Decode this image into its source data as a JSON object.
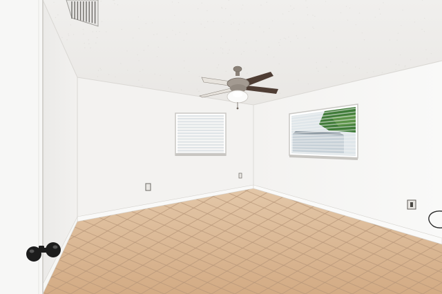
{
  "scene": {
    "type": "photo",
    "subject": "empty-room",
    "colors": {
      "ceiling": "#f1f0ee",
      "wall_left": "#f3f2f0",
      "wall_back": "#f4f3f1",
      "wall_right": "#f6f5f3",
      "floor_tile": "#d9b895",
      "grout": "#b8977a",
      "baseboard": "#f8f8f6",
      "door_edge": "#ececea",
      "fan_metal": "#8a8178",
      "fan_blade": "#4e3d34",
      "knob": "#1c1c1c",
      "window_glass": "#dfe6ea",
      "foliage": "#3f7b38",
      "outlet": "#e8e6e2"
    }
  }
}
